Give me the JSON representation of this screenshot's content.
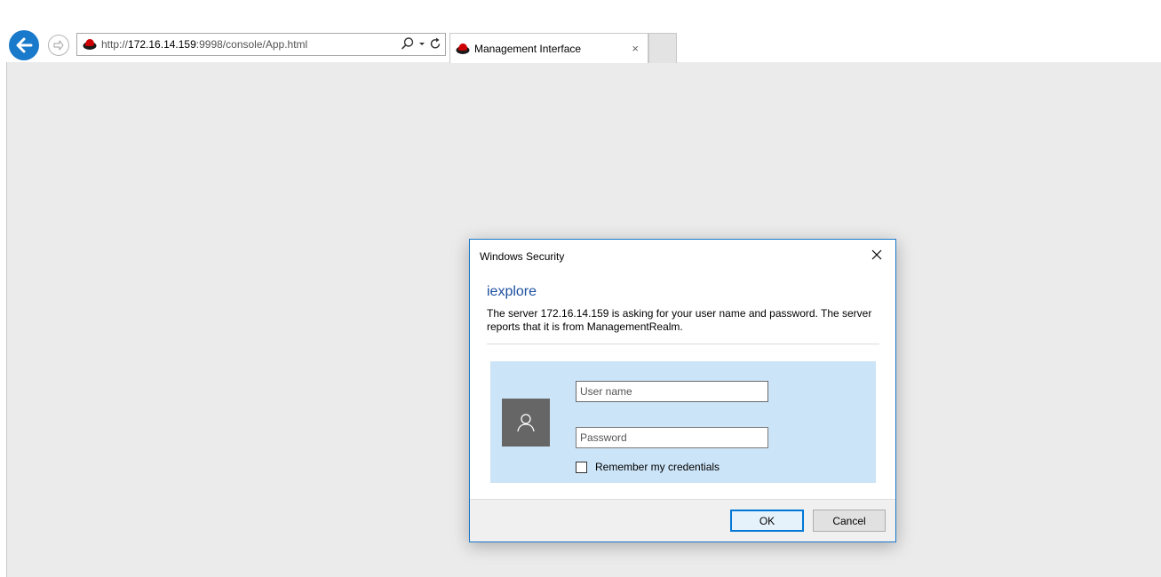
{
  "browser": {
    "address": {
      "prefix": "http://",
      "host": "172.16.14.159",
      "rest": ":9998/console/App.html"
    },
    "tab": {
      "title": "Management Interface",
      "close": "×"
    },
    "icons": {
      "back": "back-arrow-icon",
      "forward": "forward-arrow-icon",
      "search": "search-icon",
      "dropdown": "dropdown-icon",
      "refresh": "refresh-icon",
      "favicon": "redhat-favicon-icon"
    },
    "colors": {
      "accent": "#1979ca"
    }
  },
  "dialog": {
    "window_title": "Windows Security",
    "app_name": "iexplore",
    "message": "The server 172.16.14.159 is asking for your user name and password. The server reports that it is from ManagementRealm.",
    "username_placeholder": "User name",
    "password_placeholder": "Password",
    "remember_label": "Remember my credentials",
    "ok_label": "OK",
    "cancel_label": "Cancel",
    "colors": {
      "panel": "#cce4f7",
      "title_text": "#1b4f9e"
    }
  }
}
